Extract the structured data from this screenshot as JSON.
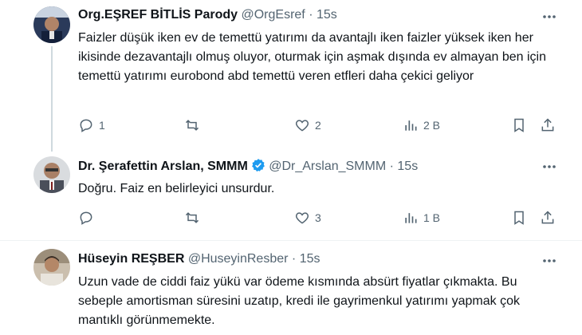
{
  "tweets": [
    {
      "name": "Org.EŞREF BİTLİS Parody",
      "handle": "@OrgEsref",
      "dot": "·",
      "time": "15s",
      "text": "Faizler düşük iken ev de temettü yatırımı da avantajlı iken faizler yüksek iken her ikisinde dezavantajlı olmuş oluyor, oturmak için aşmak dışında ev almayan ben için temettü yatırımı eurobond abd temettü veren etfleri daha çekici geliyor",
      "replies": "1",
      "retweets": "",
      "likes": "2",
      "views": "2 B"
    },
    {
      "name": "Dr. Şerafettin Arslan, SMMM",
      "handle": "@Dr_Arslan_SMMM",
      "dot": "·",
      "time": "15s",
      "verified": true,
      "text": "Doğru. Faiz en belirleyici unsurdur.",
      "replies": "",
      "retweets": "",
      "likes": "3",
      "views": "1 B"
    },
    {
      "name": "Hüseyin REŞBER",
      "handle": "@HuseyinResber",
      "dot": "·",
      "time": "15s",
      "text": "Uzun vade de ciddi faiz yükü var ödeme kısmında absürt fiyatlar çıkmakta. Bu sebeple amortisman süresini uzatıp, kredi ile gayrimenkul yatırımı yapmak çok mantıklı görünmemekte."
    }
  ],
  "colors": {
    "text": "#0f1419",
    "muted": "#536471",
    "verified": "#1d9bf0",
    "divider": "#eff3f4"
  }
}
